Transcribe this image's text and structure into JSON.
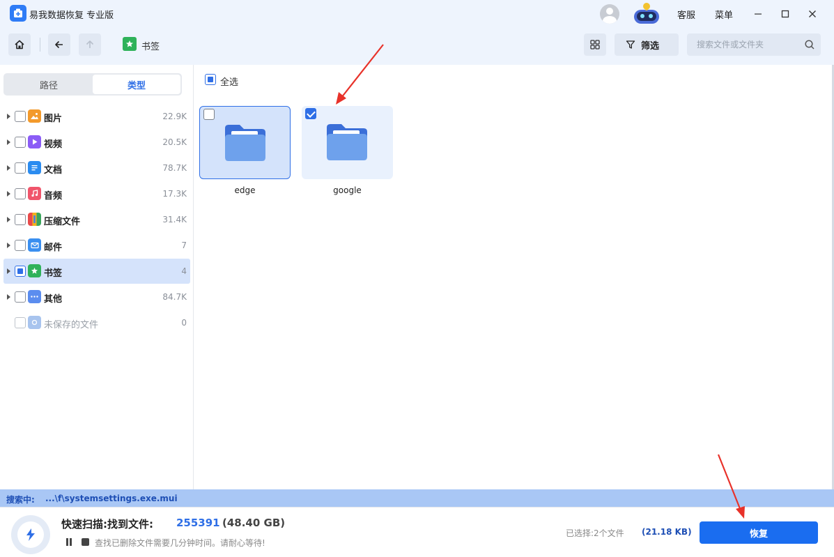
{
  "app": {
    "title": "易我数据恢复 专业版",
    "service_label": "客服",
    "menu_label": "菜单"
  },
  "toolbar": {
    "breadcrumb": "书签",
    "filter_label": "筛选",
    "search_placeholder": "搜索文件或文件夹"
  },
  "sidebar": {
    "tabs": [
      "路径",
      "类型"
    ],
    "active_tab": "类型",
    "categories": [
      {
        "name": "图片",
        "count": "22.9K",
        "icon": "image-icon",
        "color": "#f39a2b"
      },
      {
        "name": "视频",
        "count": "20.5K",
        "icon": "video-icon",
        "color": "#8b5cf6"
      },
      {
        "name": "文档",
        "count": "78.7K",
        "icon": "document-icon",
        "color": "#2b8cf0"
      },
      {
        "name": "音频",
        "count": "17.3K",
        "icon": "music-icon",
        "color": "#f0556b"
      },
      {
        "name": "压缩文件",
        "count": "31.4K",
        "icon": "archive-icon",
        "color": "#e8a21a"
      },
      {
        "name": "邮件",
        "count": "7",
        "icon": "mail-icon",
        "color": "#3a8ff0"
      },
      {
        "name": "书签",
        "count": "4",
        "icon": "bookmark-icon",
        "color": "#2fb25a"
      },
      {
        "name": "其他",
        "count": "84.7K",
        "icon": "other-folder-icon",
        "color": "#5b8def"
      },
      {
        "name": "未保存的文件",
        "count": "0",
        "icon": "unsaved-file-icon",
        "color": "#a8c4ee"
      }
    ]
  },
  "content": {
    "select_all_label": "全选",
    "items": [
      {
        "name": "edge",
        "checked": false
      },
      {
        "name": "google",
        "checked": true
      }
    ]
  },
  "status": {
    "label": "搜索中:",
    "path": "...\\f\\systemsettings.exe.mui"
  },
  "footer": {
    "scan_title": "快速扫描:找到文件:",
    "scan_count": "255391",
    "scan_size": "(48.40 GB)",
    "hint": "查找已删除文件需要几分钟时间。请耐心等待!",
    "selected_info": "已选择:2个文件",
    "selected_size": "(21.18 KB)",
    "recover_label": "恢复"
  },
  "colors": {
    "accent": "#2f6fe6",
    "primary_button": "#1a6df0",
    "annotation": "#e8322a"
  }
}
